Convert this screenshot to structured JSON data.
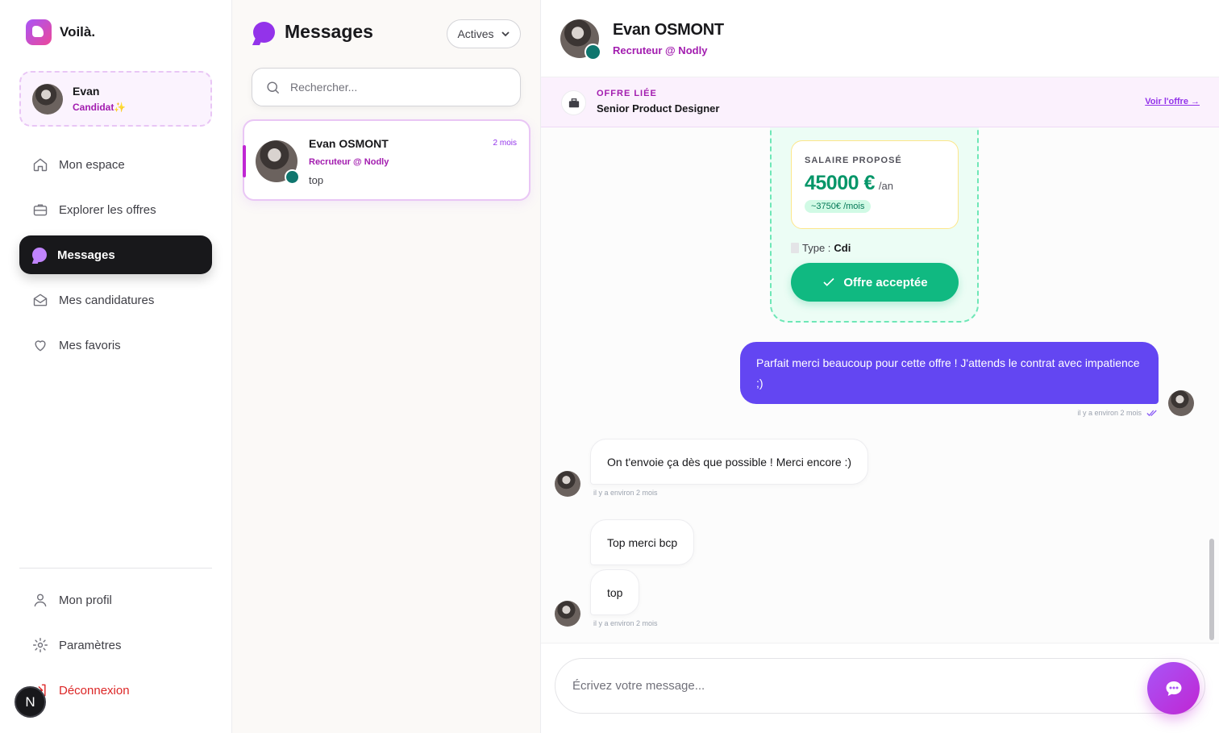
{
  "brand": {
    "name": "Voilà."
  },
  "user": {
    "name": "Evan",
    "role": "Candidat",
    "role_sparkle": "✨"
  },
  "nav": {
    "items": [
      {
        "label": "Mon espace",
        "icon": "home-icon"
      },
      {
        "label": "Explorer les offres",
        "icon": "briefcase-icon"
      },
      {
        "label": "Messages",
        "icon": "chat-icon",
        "active": true
      },
      {
        "label": "Mes candidatures",
        "icon": "envelope-icon"
      },
      {
        "label": "Mes favoris",
        "icon": "heart-icon"
      }
    ],
    "bottom": [
      {
        "label": "Mon profil",
        "icon": "user-icon"
      },
      {
        "label": "Paramètres",
        "icon": "gear-icon"
      },
      {
        "label": "Déconnexion",
        "icon": "logout-icon"
      }
    ],
    "badge": "N"
  },
  "conversations": {
    "title": "Messages",
    "filter": "Actives",
    "search_placeholder": "Rechercher...",
    "items": [
      {
        "name": "Evan OSMONT",
        "time": "2 mois",
        "subtitle": "Recruteur @ Nodly",
        "preview": "top"
      }
    ]
  },
  "chat": {
    "name": "Evan OSMONT",
    "subtitle": "Recruteur @ Nodly",
    "linked_offer": {
      "label": "OFFRE LIÉE",
      "title": "Senior Product Designer",
      "link": "Voir l'offre →"
    },
    "offer_card": {
      "salary_label": "SALAIRE PROPOSÉ",
      "salary_amount": "45000 €",
      "salary_unit": "/an",
      "salary_month": "~3750€ /mois",
      "type_label": "Type :",
      "type_value": "Cdi",
      "status_button": "Offre acceptée"
    },
    "messages": [
      {
        "direction": "out",
        "text": "Parfait merci beaucoup pour cette offre ! J'attends le contrat avec impatience ;)",
        "time": "il y a environ 2 mois"
      },
      {
        "direction": "in",
        "text": "On t'envoie ça dès que possible ! Merci encore :)",
        "time": "il y a environ 2 mois"
      },
      {
        "direction": "in",
        "text": "Top merci bcp"
      },
      {
        "direction": "in",
        "text": "top",
        "time": "il y a environ 2 mois"
      }
    ],
    "composer_placeholder": "Écrivez votre message..."
  },
  "colors": {
    "accent": "#a21caf",
    "out_bubble": "#6346f2",
    "success": "#10b981",
    "dark": "#18181b"
  }
}
